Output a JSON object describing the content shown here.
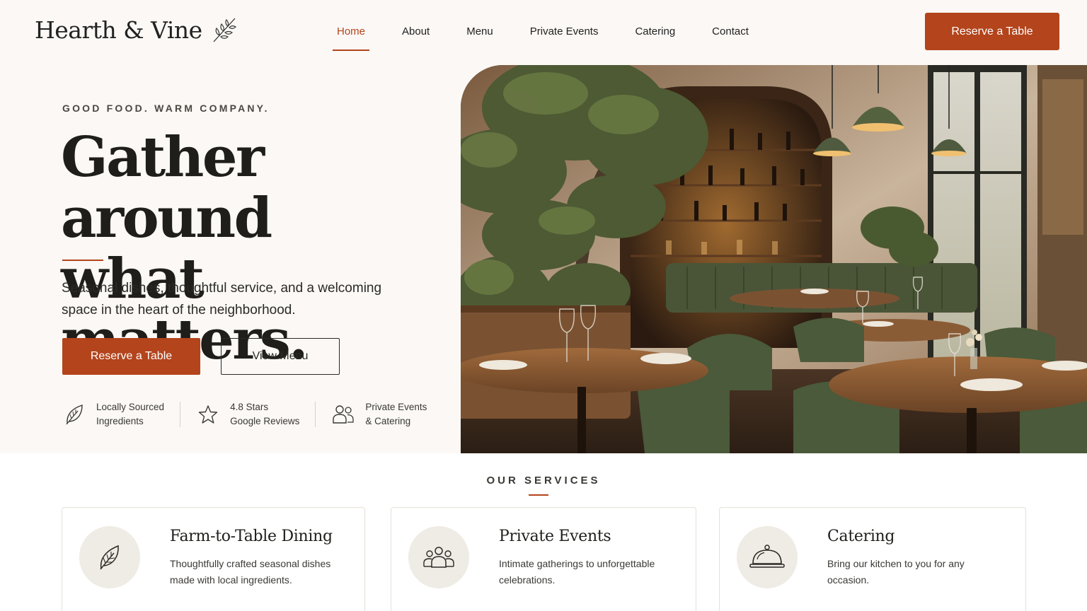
{
  "header": {
    "logo": "Hearth & Vine",
    "logo_icon": "olive-branch-icon",
    "nav": [
      {
        "label": "Home",
        "active": true
      },
      {
        "label": "About",
        "active": false
      },
      {
        "label": "Menu",
        "active": false
      },
      {
        "label": "Private Events",
        "active": false
      },
      {
        "label": "Catering",
        "active": false
      },
      {
        "label": "Contact",
        "active": false
      }
    ],
    "cta_label": "Reserve a Table"
  },
  "hero": {
    "eyebrow": "GOOD FOOD. WARM COMPANY.",
    "title_line1": "Gather around",
    "title_line2": "what matters.",
    "subtitle": "Seasonal dishes, thoughtful service, and a welcoming space in the heart of the neighborhood.",
    "primary_label": "Reserve a Table",
    "secondary_label": "View Menu",
    "features": [
      {
        "icon": "leaf-icon",
        "line1": "Locally Sourced",
        "line2": "Ingredients"
      },
      {
        "icon": "star-icon",
        "line1": "4.8 Stars",
        "line2": "Google Reviews"
      },
      {
        "icon": "people-icon",
        "line1": "Private Events",
        "line2": "& Catering"
      }
    ],
    "image": "restaurant-interior-photo"
  },
  "services": {
    "label": "OUR SERVICES",
    "cards": [
      {
        "icon": "leaf-icon",
        "title": "Farm-to-Table Dining",
        "desc": "Thoughtfully crafted seasonal dishes made with local ingredients."
      },
      {
        "icon": "group-icon",
        "title": "Private Events",
        "desc": "Intimate gatherings to unforgettable celebrations."
      },
      {
        "icon": "cloche-icon",
        "title": "Catering",
        "desc": "Bring our kitchen to you for any occasion."
      }
    ]
  },
  "colors": {
    "accent": "#b3441c",
    "background": "#fbf8f5",
    "text": "#1f1e1b",
    "icon_circle": "#efebe5"
  }
}
